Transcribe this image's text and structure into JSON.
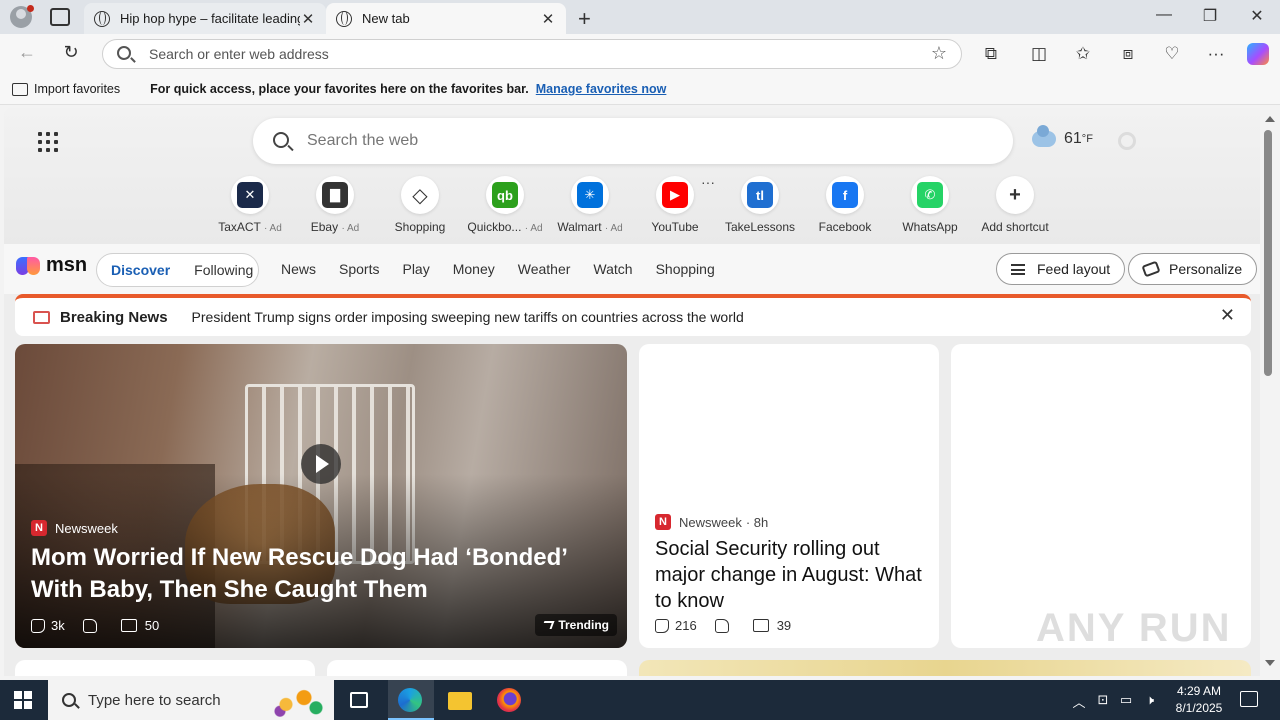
{
  "browser": {
    "tabs": [
      {
        "title": "Hip hop hype – facilitate leading-"
      },
      {
        "title": "New tab"
      }
    ],
    "address_placeholder": "Search or enter web address",
    "favorites_bar": {
      "import_label": "Import favorites",
      "message": "For quick access, place your favorites here on the favorites bar.",
      "link": "Manage favorites now"
    }
  },
  "newtab": {
    "search_placeholder": "Search the web",
    "weather": {
      "temp": "61",
      "unit": "°F"
    },
    "shortcuts": [
      {
        "label": "TaxACT",
        "ad": "· Ad",
        "icon": "taxact-icon",
        "color": "#1b2a4a",
        "glyph": "✕"
      },
      {
        "label": "Ebay",
        "ad": "· Ad",
        "icon": "ebay-bag-icon",
        "color": "#333333",
        "glyph": "▇"
      },
      {
        "label": "Shopping",
        "ad": "",
        "icon": "shopping-tag-icon",
        "color": "#ffffff",
        "glyph": "◇"
      },
      {
        "label": "Quickbo...",
        "ad": "· Ad",
        "icon": "quickbooks-icon",
        "color": "#2ca01c",
        "glyph": "qb"
      },
      {
        "label": "Walmart",
        "ad": "· Ad",
        "icon": "walmart-icon",
        "color": "#0071dc",
        "glyph": "✳"
      },
      {
        "label": "YouTube",
        "ad": "",
        "icon": "youtube-icon",
        "color": "#ff0000",
        "glyph": "▶"
      },
      {
        "label": "TakeLessons",
        "ad": "",
        "icon": "takelessons-icon",
        "color": "#1f6fd1",
        "glyph": "tl"
      },
      {
        "label": "Facebook",
        "ad": "",
        "icon": "facebook-icon",
        "color": "#1877f2",
        "glyph": "f"
      },
      {
        "label": "WhatsApp",
        "ad": "",
        "icon": "whatsapp-icon",
        "color": "#25d366",
        "glyph": "✆"
      },
      {
        "label": "Add shortcut",
        "ad": "",
        "icon": "plus-icon",
        "color": "#ffffff",
        "glyph": "+"
      }
    ]
  },
  "msn": {
    "logo_text": "msn",
    "segments": {
      "active": "Discover",
      "inactive": "Following"
    },
    "nav": [
      "News",
      "Sports",
      "Play",
      "Money",
      "Weather",
      "Watch",
      "Shopping"
    ],
    "feed_layout": "Feed layout",
    "personalize": "Personalize",
    "breaking": {
      "label": "Breaking News",
      "text": "President Trump signs order imposing sweeping new tariffs on countries across the world"
    },
    "hero": {
      "source": "Newsweek",
      "headline": "Mom Worried If New Rescue Dog Had ‘Bonded’ With Baby, Then She Caught Them",
      "likes": "3k",
      "comments": "50",
      "badge": "Trending"
    },
    "card2": {
      "source": "Newsweek",
      "age": "· 8h",
      "headline": "Social Security rolling out major change in August: What to know",
      "likes": "216",
      "comments": "39"
    }
  },
  "watermark": "ANY RUN",
  "taskbar": {
    "search_placeholder": "Type here to search",
    "time": "4:29 AM",
    "date": "8/1/2025"
  }
}
